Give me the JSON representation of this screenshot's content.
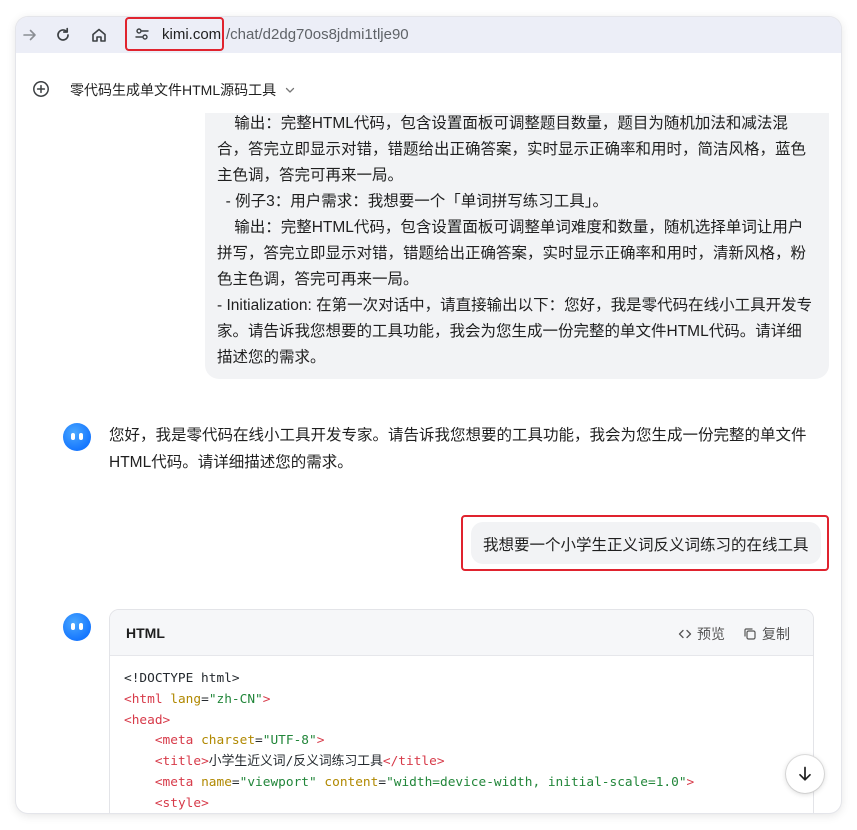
{
  "browser": {
    "url_domain": "kimi.com",
    "url_path": "/chat/d2dg70os8jdmi1tlje90"
  },
  "chat": {
    "title": "零代码生成单文件HTML源码工具",
    "messages": {
      "user_prompt_tail": "    输出：完整HTML代码，包含设置面板可调整题目数量，题目为随机加法和减法混合，答完立即显示对错，错题给出正确答案，实时显示正确率和用时，简洁风格，蓝色主色调，答完可再来一局。\n  - 例子3：用户需求：我想要一个「单词拼写练习工具」。\n    输出：完整HTML代码，包含设置面板可调整单词难度和数量，随机选择单词让用户拼写，答完立即显示对错，错题给出正确答案，实时显示正确率和用时，清新风格，粉色主色调，答完可再来一局。\n- Initialization: 在第一次对话中，请直接输出以下：您好，我是零代码在线小工具开发专家。请告诉我您想要的工具功能，我会为您生成一份完整的单文件HTML代码。请详细描述您的需求。",
      "assistant_greeting": "您好，我是零代码在线小工具开发专家。请告诉我您想要的工具功能，我会为您生成一份完整的单文件HTML代码。请详细描述您的需求。",
      "user_request": "我想要一个小学生正义词反义词练习的在线工具"
    },
    "code_block": {
      "language": "HTML",
      "preview_label": "预览",
      "copy_label": "复制",
      "lines": {
        "l1": "<!DOCTYPE html>",
        "l2_open": "<",
        "l2_tag": "html",
        "l2_attr": "lang",
        "l2_eq": "=",
        "l2_val": "\"zh-CN\"",
        "l2_close": ">",
        "l3_open": "<",
        "l3_tag": "head",
        "l3_close": ">",
        "l4_open": "<",
        "l4_tag": "meta",
        "l4_attr": "charset",
        "l4_eq": "=",
        "l4_val": "\"UTF-8\"",
        "l4_close": ">",
        "l5_open": "<",
        "l5_tag": "title",
        "l5_close": ">",
        "l5_text": "小学生近义词/反义词练习工具",
        "l5_end_open": "</",
        "l5_end_tag": "title",
        "l5_end_close": ">",
        "l6_open": "<",
        "l6_tag": "meta",
        "l6_attr1": "name",
        "l6_eq1": "=",
        "l6_val1": "\"viewport\"",
        "l6_attr2": "content",
        "l6_eq2": "=",
        "l6_val2": "\"width=device-width, initial-scale=1.0\"",
        "l6_close": ">",
        "l7_open": "<",
        "l7_tag": "style",
        "l7_close": ">"
      }
    }
  },
  "icons": [
    "forward-icon",
    "reload-icon",
    "home-icon",
    "site-info-icon",
    "new-chat-icon",
    "chevron-down-icon",
    "assistant-avatar",
    "preview-icon",
    "copy-icon",
    "arrow-down-icon"
  ],
  "colors": {
    "accent": "#1677ff",
    "highlight": "#e0232e"
  }
}
